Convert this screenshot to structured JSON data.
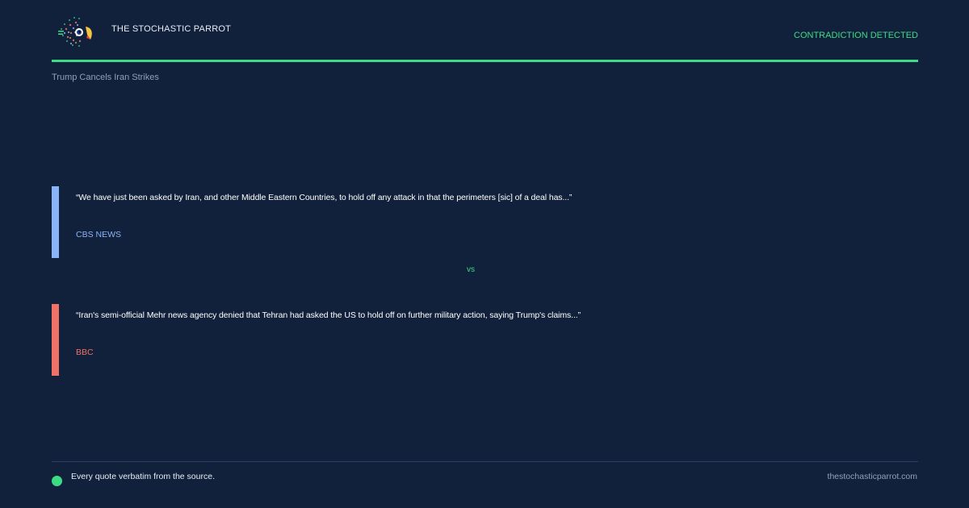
{
  "header": {
    "brand": "THE STOCHASTIC PARROT",
    "status": "CONTRADICTION DETECTED",
    "logo_icon": "parrot-logo-icon"
  },
  "topic": "Trump Cancels Iran Strikes",
  "quotes": [
    {
      "text": "“We have just been asked by Iran, and other Middle Eastern Countries, to hold off any attack in that the perimeters [sic] of a deal has...”",
      "source_icon": "",
      "source": "CBS NEWS",
      "color": "#8ab4f8"
    },
    {
      "text": "“Iran's semi-official Mehr news agency denied that Tehran had asked the US to hold off on further military action, saying Trump's claims...”",
      "source_icon": "",
      "source": "BBC",
      "color": "#f07167"
    }
  ],
  "vs": "vs",
  "footer": {
    "note": "Every quote verbatim from the source.",
    "site": "thestochasticparrot.com"
  },
  "colors": {
    "background": "#12213b",
    "accent": "#3ddc84"
  }
}
